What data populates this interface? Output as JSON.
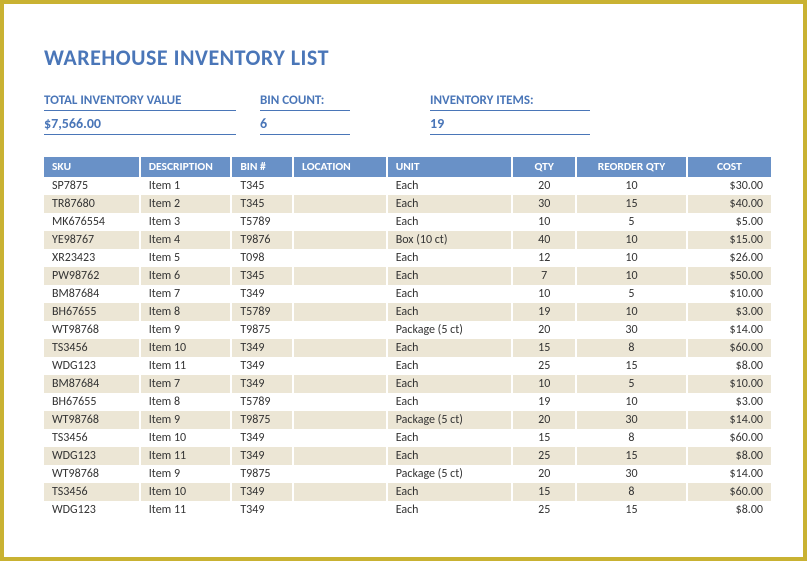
{
  "title": "WAREHOUSE INVENTORY LIST",
  "summary": {
    "totalLabel": "TOTAL INVENTORY VALUE",
    "totalValue": "$7,566.00",
    "binLabel": "BIN COUNT:",
    "binValue": "6",
    "itemsLabel": "INVENTORY ITEMS:",
    "itemsValue": "19"
  },
  "columns": {
    "sku": "SKU",
    "desc": "DESCRIPTION",
    "bin": "BIN #",
    "loc": "LOCATION",
    "unit": "UNIT",
    "qty": "QTY",
    "reorder": "REORDER QTY",
    "cost": "COST"
  },
  "rows": [
    {
      "sku": "SP7875",
      "desc": "Item 1",
      "bin": "T345",
      "loc": "",
      "unit": "Each",
      "qty": "20",
      "reorder": "10",
      "cost": "$30.00"
    },
    {
      "sku": "TR87680",
      "desc": "Item 2",
      "bin": "T345",
      "loc": "",
      "unit": "Each",
      "qty": "30",
      "reorder": "15",
      "cost": "$40.00"
    },
    {
      "sku": "MK676554",
      "desc": "Item 3",
      "bin": "T5789",
      "loc": "",
      "unit": "Each",
      "qty": "10",
      "reorder": "5",
      "cost": "$5.00"
    },
    {
      "sku": "YE98767",
      "desc": "Item 4",
      "bin": "T9876",
      "loc": "",
      "unit": "Box (10 ct)",
      "qty": "40",
      "reorder": "10",
      "cost": "$15.00"
    },
    {
      "sku": "XR23423",
      "desc": "Item 5",
      "bin": "T098",
      "loc": "",
      "unit": "Each",
      "qty": "12",
      "reorder": "10",
      "cost": "$26.00"
    },
    {
      "sku": "PW98762",
      "desc": "Item 6",
      "bin": "T345",
      "loc": "",
      "unit": "Each",
      "qty": "7",
      "reorder": "10",
      "cost": "$50.00"
    },
    {
      "sku": "BM87684",
      "desc": "Item 7",
      "bin": "T349",
      "loc": "",
      "unit": "Each",
      "qty": "10",
      "reorder": "5",
      "cost": "$10.00"
    },
    {
      "sku": "BH67655",
      "desc": "Item 8",
      "bin": "T5789",
      "loc": "",
      "unit": "Each",
      "qty": "19",
      "reorder": "10",
      "cost": "$3.00"
    },
    {
      "sku": "WT98768",
      "desc": "Item 9",
      "bin": "T9875",
      "loc": "",
      "unit": "Package (5 ct)",
      "qty": "20",
      "reorder": "30",
      "cost": "$14.00"
    },
    {
      "sku": "TS3456",
      "desc": "Item 10",
      "bin": "T349",
      "loc": "",
      "unit": "Each",
      "qty": "15",
      "reorder": "8",
      "cost": "$60.00"
    },
    {
      "sku": "WDG123",
      "desc": "Item 11",
      "bin": "T349",
      "loc": "",
      "unit": "Each",
      "qty": "25",
      "reorder": "15",
      "cost": "$8.00"
    },
    {
      "sku": "BM87684",
      "desc": "Item 7",
      "bin": "T349",
      "loc": "",
      "unit": "Each",
      "qty": "10",
      "reorder": "5",
      "cost": "$10.00"
    },
    {
      "sku": "BH67655",
      "desc": "Item 8",
      "bin": "T5789",
      "loc": "",
      "unit": "Each",
      "qty": "19",
      "reorder": "10",
      "cost": "$3.00"
    },
    {
      "sku": "WT98768",
      "desc": "Item 9",
      "bin": "T9875",
      "loc": "",
      "unit": "Package (5 ct)",
      "qty": "20",
      "reorder": "30",
      "cost": "$14.00"
    },
    {
      "sku": "TS3456",
      "desc": "Item 10",
      "bin": "T349",
      "loc": "",
      "unit": "Each",
      "qty": "15",
      "reorder": "8",
      "cost": "$60.00"
    },
    {
      "sku": "WDG123",
      "desc": "Item 11",
      "bin": "T349",
      "loc": "",
      "unit": "Each",
      "qty": "25",
      "reorder": "15",
      "cost": "$8.00"
    },
    {
      "sku": "WT98768",
      "desc": "Item 9",
      "bin": "T9875",
      "loc": "",
      "unit": "Package (5 ct)",
      "qty": "20",
      "reorder": "30",
      "cost": "$14.00"
    },
    {
      "sku": "TS3456",
      "desc": "Item 10",
      "bin": "T349",
      "loc": "",
      "unit": "Each",
      "qty": "15",
      "reorder": "8",
      "cost": "$60.00"
    },
    {
      "sku": "WDG123",
      "desc": "Item 11",
      "bin": "T349",
      "loc": "",
      "unit": "Each",
      "qty": "25",
      "reorder": "15",
      "cost": "$8.00"
    }
  ]
}
